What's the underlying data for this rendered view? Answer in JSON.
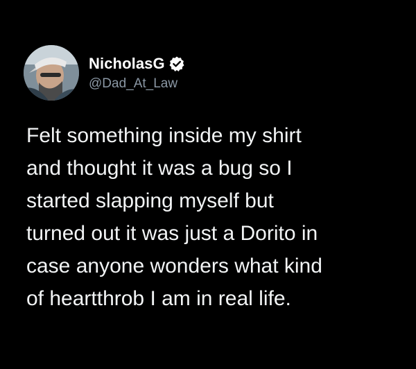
{
  "user": {
    "display_name": "NicholasG",
    "handle": "@Dad_At_Law",
    "verified_icon": "verified-badge-icon"
  },
  "tweet": {
    "text": "Felt something inside my shirt\nand thought it was a bug so I\nstarted slapping myself but\nturned out it was just a Dorito in\ncase anyone wonders what kind\nof heartthrob I am in real life."
  },
  "colors": {
    "background": "#000000",
    "text": "#f2f4f5",
    "name": "#ffffff",
    "handle": "#8b98a5"
  }
}
